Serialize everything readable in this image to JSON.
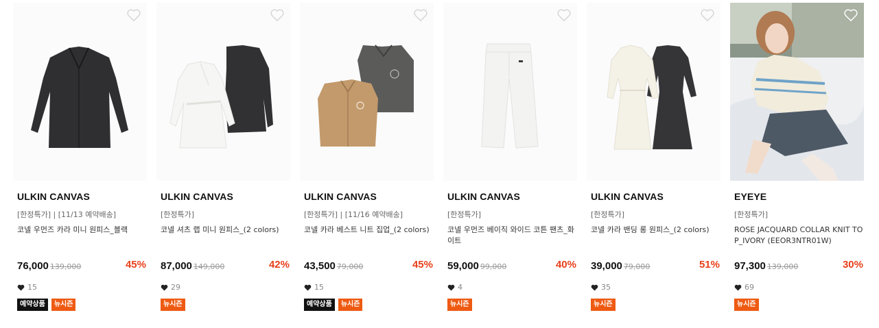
{
  "colors": {
    "discount": "#e8401a",
    "badge_preorder": "#111111",
    "badge_new_season": "#ee5a12"
  },
  "products": [
    {
      "brand": "ULKIN CANVAS",
      "tag": "[한정특가] | [11/13 예약배송]",
      "name": "코넬 우먼즈 카라 미니 원피스_블랙",
      "price": "76,000",
      "original_price": "139,000",
      "discount": "45%",
      "likes": "15",
      "badges": [
        "예약상품",
        "뉴시즌"
      ],
      "image": "black-mini-dress"
    },
    {
      "brand": "ULKIN CANVAS",
      "tag": "[한정특가]",
      "name": "코넬 셔츠 랩 미니 원피스_(2 colors)",
      "price": "87,000",
      "original_price": "149,000",
      "discount": "42%",
      "likes": "29",
      "badges": [
        "뉴시즌"
      ],
      "image": "white-and-black-wrap-dresses"
    },
    {
      "brand": "ULKIN CANVAS",
      "tag": "[한정특가] | [11/16 예약배송]",
      "name": "코넬 카라 베스트 니트 집업_(2 colors)",
      "price": "43,500",
      "original_price": "79,000",
      "discount": "45%",
      "likes": "15",
      "badges": [
        "예약상품",
        "뉴시즌"
      ],
      "image": "beige-and-gray-knit-vests"
    },
    {
      "brand": "ULKIN CANVAS",
      "tag": "[한정특가]",
      "name": "코넬 우먼즈 베이직 와이드 코튼 팬츠_화이트",
      "price": "59,000",
      "original_price": "99,000",
      "discount": "40%",
      "likes": "4",
      "badges": [
        "뉴시즌"
      ],
      "image": "white-wide-pants"
    },
    {
      "brand": "ULKIN CANVAS",
      "tag": "[한정특가]",
      "name": "코넬 카라 밴딩 롱 원피스_(2 colors)",
      "price": "39,000",
      "original_price": "79,000",
      "discount": "51%",
      "likes": "35",
      "badges": [
        "뉴시즌"
      ],
      "image": "ivory-and-charcoal-long-dresses"
    },
    {
      "brand": "EYEYE",
      "tag": "[한정특가]",
      "name": "ROSE JACQUARD COLLAR KNIT TOP_IVORY (EEOR3NTR01W)",
      "price": "97,300",
      "original_price": "139,000",
      "discount": "30%",
      "likes": "69",
      "badges": [
        "뉴시즌"
      ],
      "image": "model-in-knit-top-photo"
    }
  ]
}
